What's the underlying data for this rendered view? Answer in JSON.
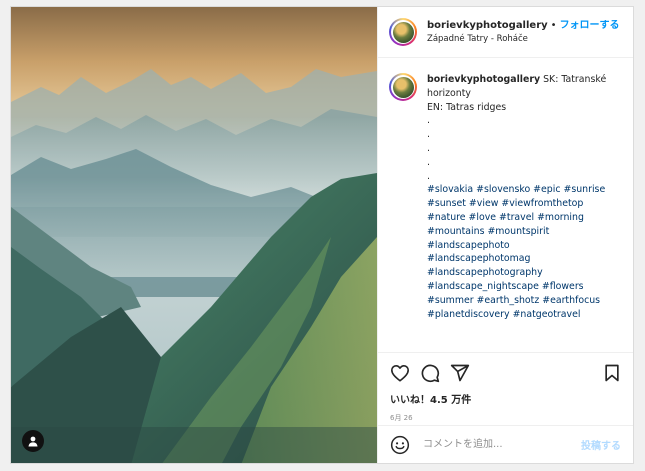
{
  "post": {
    "username": "borievkyphotogallery",
    "separator": "•",
    "follow_label": "フォローする",
    "location": "Západné Tatry - Roháče"
  },
  "caption": {
    "username": "borievkyphotogallery",
    "lines": [
      "SK: Tatranské horizonty",
      "EN: Tatras ridges",
      ".",
      ".",
      ".",
      ".",
      ".",
      "#slovakia #slovensko #epic #sunrise",
      "#sunset #view #viewfromthetop",
      "#nature #love #travel #morning",
      "#mountains #mountspirit",
      "#landscapephoto",
      "#landscapephotomag",
      "#landscapephotography",
      "#landscape_nightscape #flowers",
      "#summer #earth_shotz #earthfocus",
      "#planetdiscovery #natgeotravel"
    ]
  },
  "stats": {
    "likes": "いいね！4.5 万件",
    "date": "6月 26"
  },
  "comment_box": {
    "placeholder": "コメントを追加...",
    "post_label": "投稿する"
  },
  "icons": {
    "like": "heart-icon",
    "comment": "comment-icon",
    "share": "paper-plane-icon",
    "save": "bookmark-icon",
    "emoji": "smiley-icon",
    "tag": "user-tag-icon"
  },
  "colors": {
    "link_blue": "#0095f6",
    "hashtag": "#00376b",
    "post_disabled": "#b3dbff"
  }
}
